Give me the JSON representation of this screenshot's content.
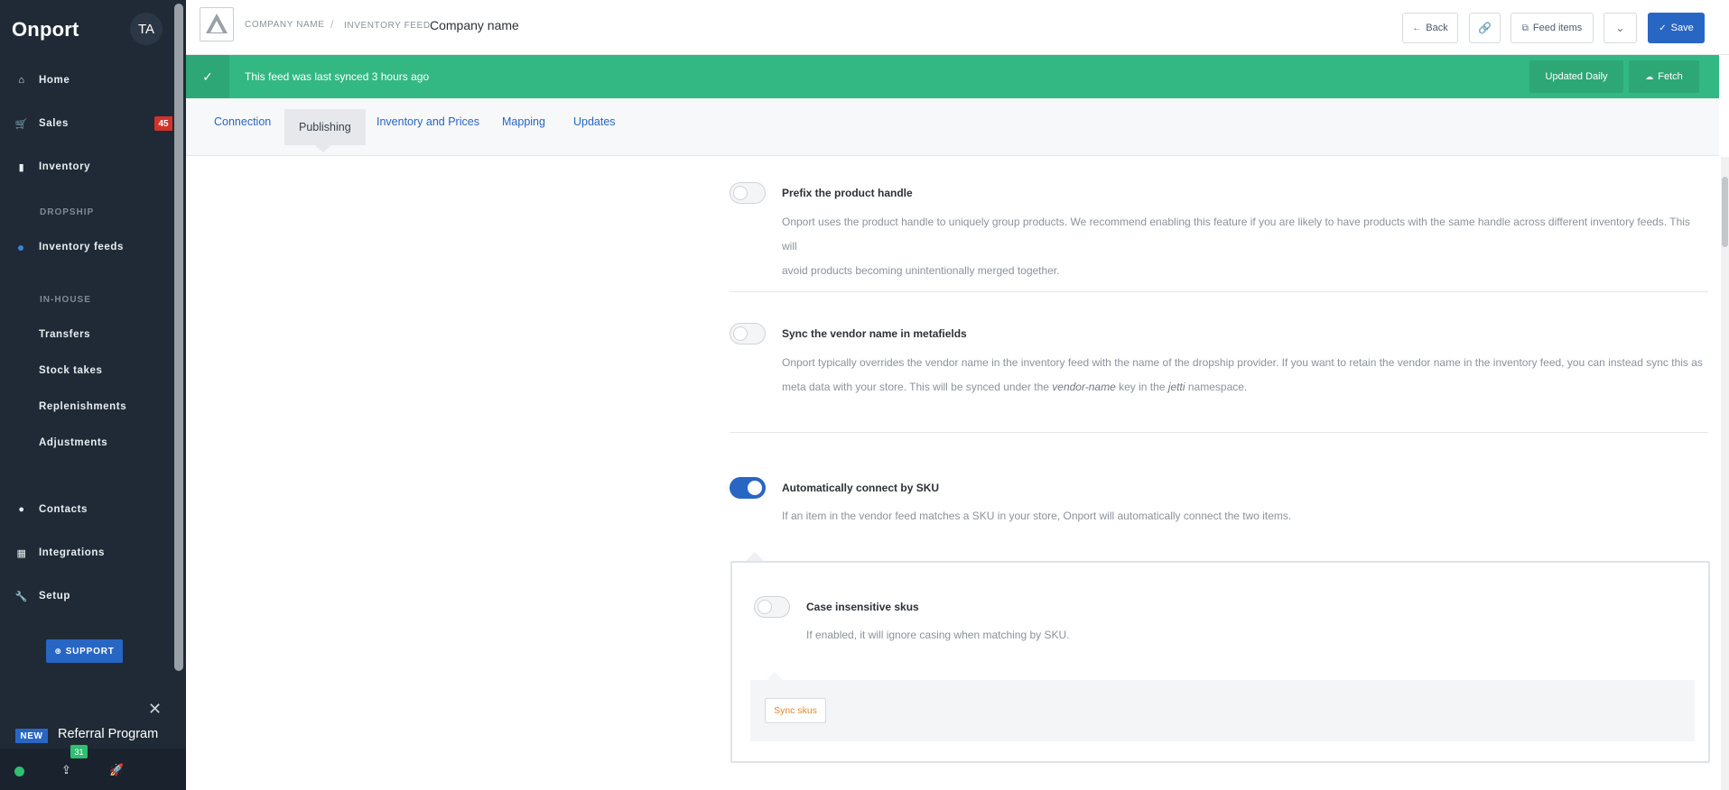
{
  "sidebar": {
    "brand": "Onport",
    "avatar": "TA",
    "items": [
      {
        "label": "Home",
        "icon": "home-icon"
      },
      {
        "label": "Sales",
        "icon": "cart-icon",
        "badge": "45"
      },
      {
        "label": "Inventory",
        "icon": "bookmark-icon"
      }
    ],
    "section_dropship": "DROPSHIP",
    "inventory_feeds": "Inventory feeds",
    "section_inhouse": "IN-HOUSE",
    "inhouse_items": [
      "Transfers",
      "Stock takes",
      "Replenishments",
      "Adjustments"
    ],
    "lower_items": [
      {
        "label": "Contacts",
        "icon": "person-icon"
      },
      {
        "label": "Integrations",
        "icon": "grid-icon"
      },
      {
        "label": "Setup",
        "icon": "wrench-icon"
      }
    ],
    "support": "SUPPORT",
    "new_badge": "NEW",
    "referral": "Referral Program",
    "notification_count": "31"
  },
  "header": {
    "crumb_company": "COMPANY NAME",
    "crumb_sep": "/",
    "crumb_feed": "INVENTORY FEED:",
    "title": "Company name",
    "back": "Back",
    "feed_items": "Feed items",
    "save": "Save"
  },
  "banner": {
    "text": "This feed was last synced 3 hours ago",
    "updated": "Updated Daily",
    "fetch": "Fetch"
  },
  "tabs": [
    "Connection",
    "Publishing",
    "Inventory and Prices",
    "Mapping",
    "Updates"
  ],
  "options": {
    "prefix_title": "Prefix the product handle",
    "prefix_desc_1": "Onport uses the product handle to uniquely group products. We recommend enabling this feature if you are likely to have products with the same handle across different inventory feeds. This will",
    "prefix_desc_2": "avoid products becoming unintentionally merged together.",
    "vendor_title": "Sync the vendor name in metafields",
    "vendor_desc_1": "Onport typically overrides the vendor name in the inventory feed with the name of the dropship provider. If you want to retain the vendor name in the inventory feed, you can instead sync this as",
    "vendor_desc_2a": "meta data with your store. This will be synced under the",
    "vendor_desc_key": "vendor-name",
    "vendor_desc_2b": "key in the",
    "vendor_desc_ns": "jetti",
    "vendor_desc_2c": "namespace.",
    "sku_title": "Automatically connect by SKU",
    "sku_desc": "If an item in the vendor feed matches a SKU in your store, Onport will automatically connect the two items.",
    "case_title": "Case insensitive skus",
    "case_desc": "If enabled, it will ignore casing when matching by SKU.",
    "sync_skus": "Sync skus"
  },
  "colors": {
    "accent": "#2866c4",
    "success": "#33b883",
    "sidebar": "#1f2a36"
  }
}
